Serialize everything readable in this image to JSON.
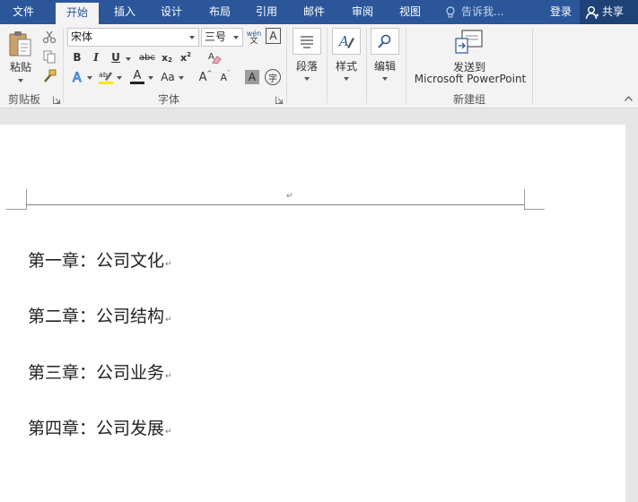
{
  "tabs": [
    {
      "label": "文件",
      "active": false
    },
    {
      "label": "开始",
      "active": true
    },
    {
      "label": "插入",
      "active": false
    },
    {
      "label": "设计",
      "active": false
    },
    {
      "label": "布局",
      "active": false
    },
    {
      "label": "引用",
      "active": false
    },
    {
      "label": "邮件",
      "active": false
    },
    {
      "label": "审阅",
      "active": false
    },
    {
      "label": "视图",
      "active": false
    }
  ],
  "tell_me": {
    "placeholder": "告诉我..."
  },
  "account": {
    "login_label": "登录",
    "share_label": "共享"
  },
  "ribbon": {
    "clipboard": {
      "group_label": "剪贴板",
      "paste_label": "粘贴"
    },
    "font": {
      "group_label": "字体",
      "font_name": "宋体",
      "font_size": "三号",
      "phonetic_glyph": "wén",
      "bold": "B",
      "italic": "I",
      "underline": "U",
      "strike": "abc",
      "subscript": "x",
      "superscript": "x",
      "font_color_glyph": "A",
      "change_case": "Aa",
      "grow": "A",
      "shrink": "A",
      "char_shading": "A",
      "enclose": "字",
      "border_char": "A"
    },
    "paragraph": {
      "label": "段落"
    },
    "styles": {
      "label": "样式"
    },
    "editing": {
      "label": "编辑"
    },
    "new_group": {
      "group_label": "新建组",
      "send_line1": "发送到",
      "send_line2": "Microsoft PowerPoint"
    }
  },
  "document": {
    "header_mark": "↵",
    "chapters": [
      "第一章：公司文化",
      "第二章：公司结构",
      "第三章：公司业务",
      "第四章：公司发展"
    ],
    "paragraph_mark": "↵"
  },
  "colors": {
    "accent": "#2b579a",
    "share_bg": "#1e4276",
    "ribbon_bg": "#f3f3f3"
  }
}
